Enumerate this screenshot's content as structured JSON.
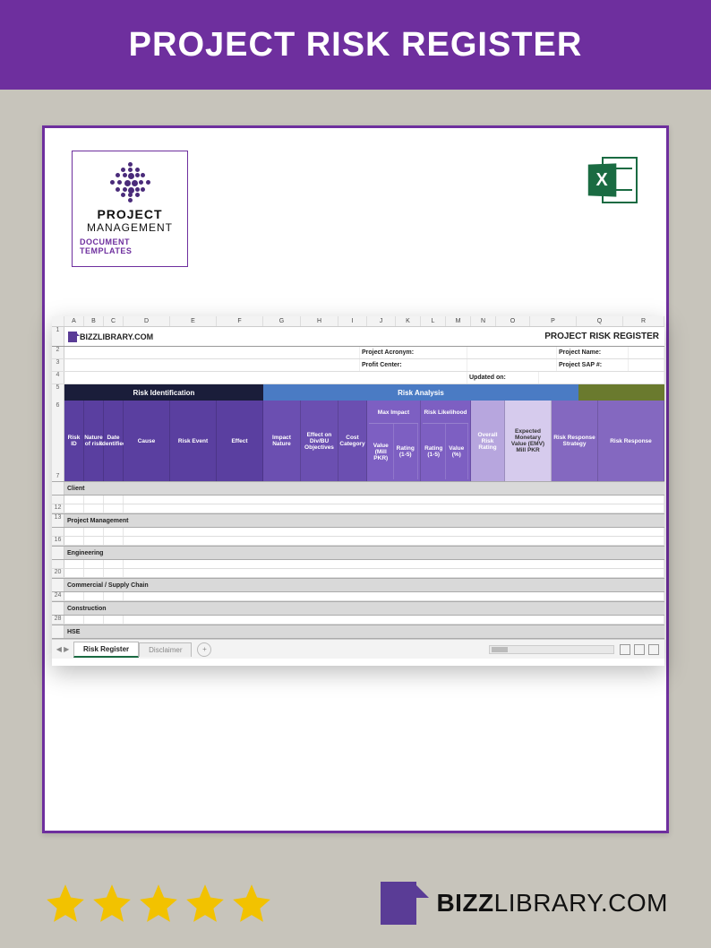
{
  "header": {
    "title": "PROJECT RISK REGISTER"
  },
  "badge": {
    "line1": "PROJECT",
    "line2": "MANAGEMENT",
    "line3": "DOCUMENT TEMPLATES"
  },
  "excel": {
    "letter": "X"
  },
  "spreadsheet": {
    "columns": [
      "A",
      "B",
      "C",
      "D",
      "E",
      "F",
      "G",
      "H",
      "I",
      "J",
      "K",
      "L",
      "M",
      "N",
      "O",
      "P",
      "Q",
      "R"
    ],
    "brand": "BIZZLIBRARY.COM",
    "doc_title": "PROJECT RISK REGISTER",
    "meta": {
      "project_acronym": "Project Acronym:",
      "profit_center": "Profit Center:",
      "project_name": "Project Name:",
      "project_sap": "Project SAP #:",
      "updated_on": "Updated on:"
    },
    "sections": {
      "identification": "Risk Identification",
      "analysis": "Risk Analysis"
    },
    "headers": {
      "risk_id": "Risk ID",
      "nature": "Nature of risk",
      "date": "Date Identified",
      "cause": "Cause",
      "event": "Risk Event",
      "effect": "Effect",
      "impact_nature": "Impact Nature",
      "effect_obj": "Effect on Div/BU Objectives",
      "cost_cat": "Cost Category",
      "max_impact": "Max Impact",
      "value_pkr": "Value (Mill PKR)",
      "rating15a": "Rating (1-5)",
      "risk_likelihood": "Risk Likelihood",
      "rating15b": "Rating (1-5)",
      "value_pct": "Value (%)",
      "overall": "Overall Risk Rating",
      "emv": "Expected Monetary Value (EMV) Mill PKR",
      "strategy": "Risk Response Strategy",
      "response": "Risk Response"
    },
    "categories": [
      "Client",
      "Project Management",
      "Engineering",
      "Commercial / Supply Chain",
      "Construction",
      "HSE"
    ],
    "row_numbers_visible": [
      "1",
      "2",
      "3",
      "4",
      "5",
      "6",
      "7",
      "",
      "12",
      "13",
      "16",
      "",
      "20",
      "",
      "24",
      "",
      "28"
    ],
    "tabs": {
      "active": "Risk Register",
      "inactive": "Disclaimer",
      "add": "+"
    }
  },
  "footer": {
    "stars": 5,
    "logo_bold": "BIZZ",
    "logo_thin": "LIBRARY",
    "logo_ext": ".COM"
  }
}
